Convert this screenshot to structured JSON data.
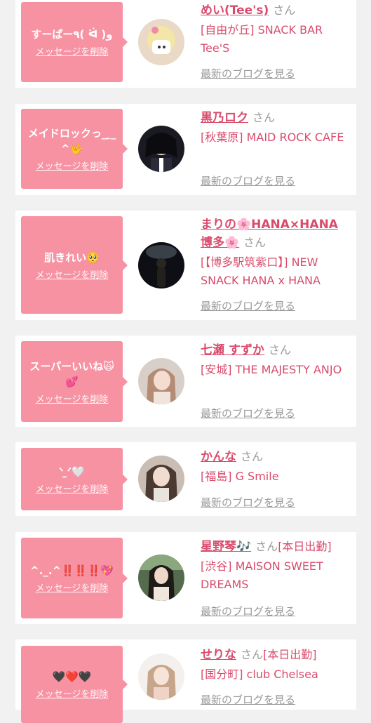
{
  "delete_label": "メッセージを削除",
  "san_label": "さん",
  "blog_label": "最新のブログを見る",
  "colors": {
    "accent": "#d94b6c",
    "bubble": "#f792a3",
    "muted": "#999999"
  },
  "entries": [
    {
      "message": "すーぱー٩( ᐛ )و",
      "name": "めい(Tee's)",
      "status": "",
      "shop": "[自由が丘] SNACK BAR Tee'S"
    },
    {
      "message": "メイドロックっ_ ̫_^🤟",
      "name": "黒乃ロク",
      "status": "",
      "shop": "[秋葉原] MAID ROCK CAFE"
    },
    {
      "message": "肌きれい🥺",
      "name": "まりの🌸HANA×HANA博多🌸",
      "status": "",
      "shop": "[【博多駅筑紫口】] NEW SNACK HANA x HANA"
    },
    {
      "message": "スーパーいいね🙀💕",
      "name": "七瀬 すずか",
      "status": "",
      "shop": "[安城] THE MAJESTY ANJO"
    },
    {
      "message": "ᐠ ̫ᐟ🤍",
      "name": "かんな",
      "status": "",
      "shop": "[福島] G Smile"
    },
    {
      "message": "^._.^‼️‼️‼️💖",
      "name": "星野琴🎶",
      "status": "[本日出勤]",
      "shop": "[渋谷] MAISON SWEET DREAMS"
    },
    {
      "message": "🖤❤️🖤",
      "name": "せりな",
      "status": "[本日出勤]",
      "shop": "[国分町] club Chelsea"
    }
  ]
}
